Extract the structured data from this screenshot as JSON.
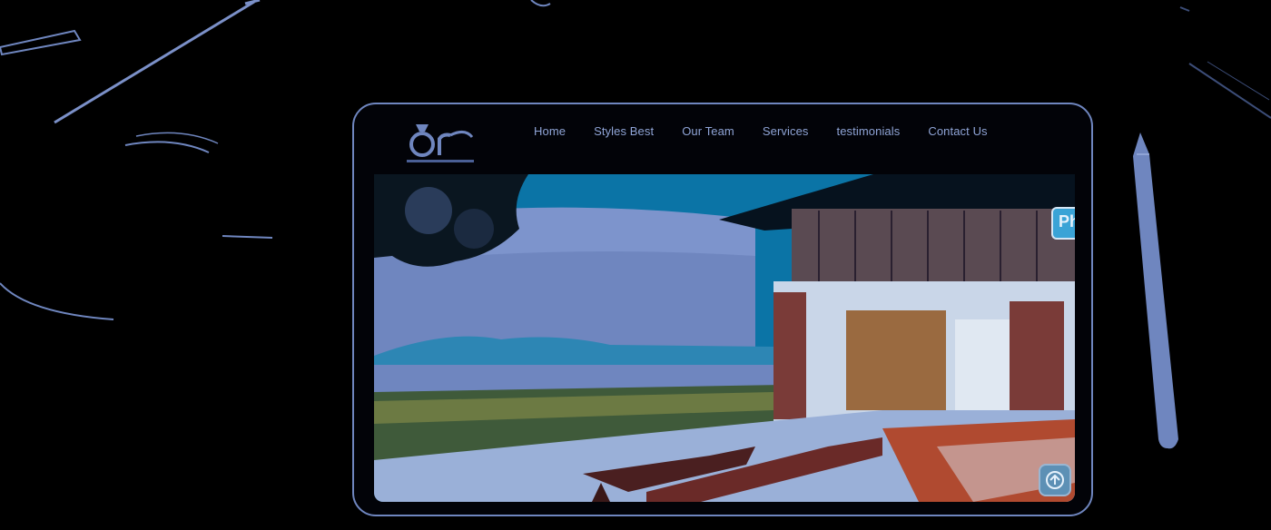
{
  "nav": {
    "items": [
      {
        "label": "Home"
      },
      {
        "label": "Styles Best"
      },
      {
        "label": "Our Team"
      },
      {
        "label": "Services"
      },
      {
        "label": "testimonials"
      },
      {
        "label": "Contact Us"
      }
    ]
  },
  "logo": {
    "icon": "brand-logo"
  },
  "hero": {
    "badge_text": "Ph",
    "scroll_icon": "arrow-up-icon"
  },
  "colors": {
    "nav_text": "#8fa4d6",
    "frame": "#6f86bf",
    "sky": "#0c6ea0"
  }
}
